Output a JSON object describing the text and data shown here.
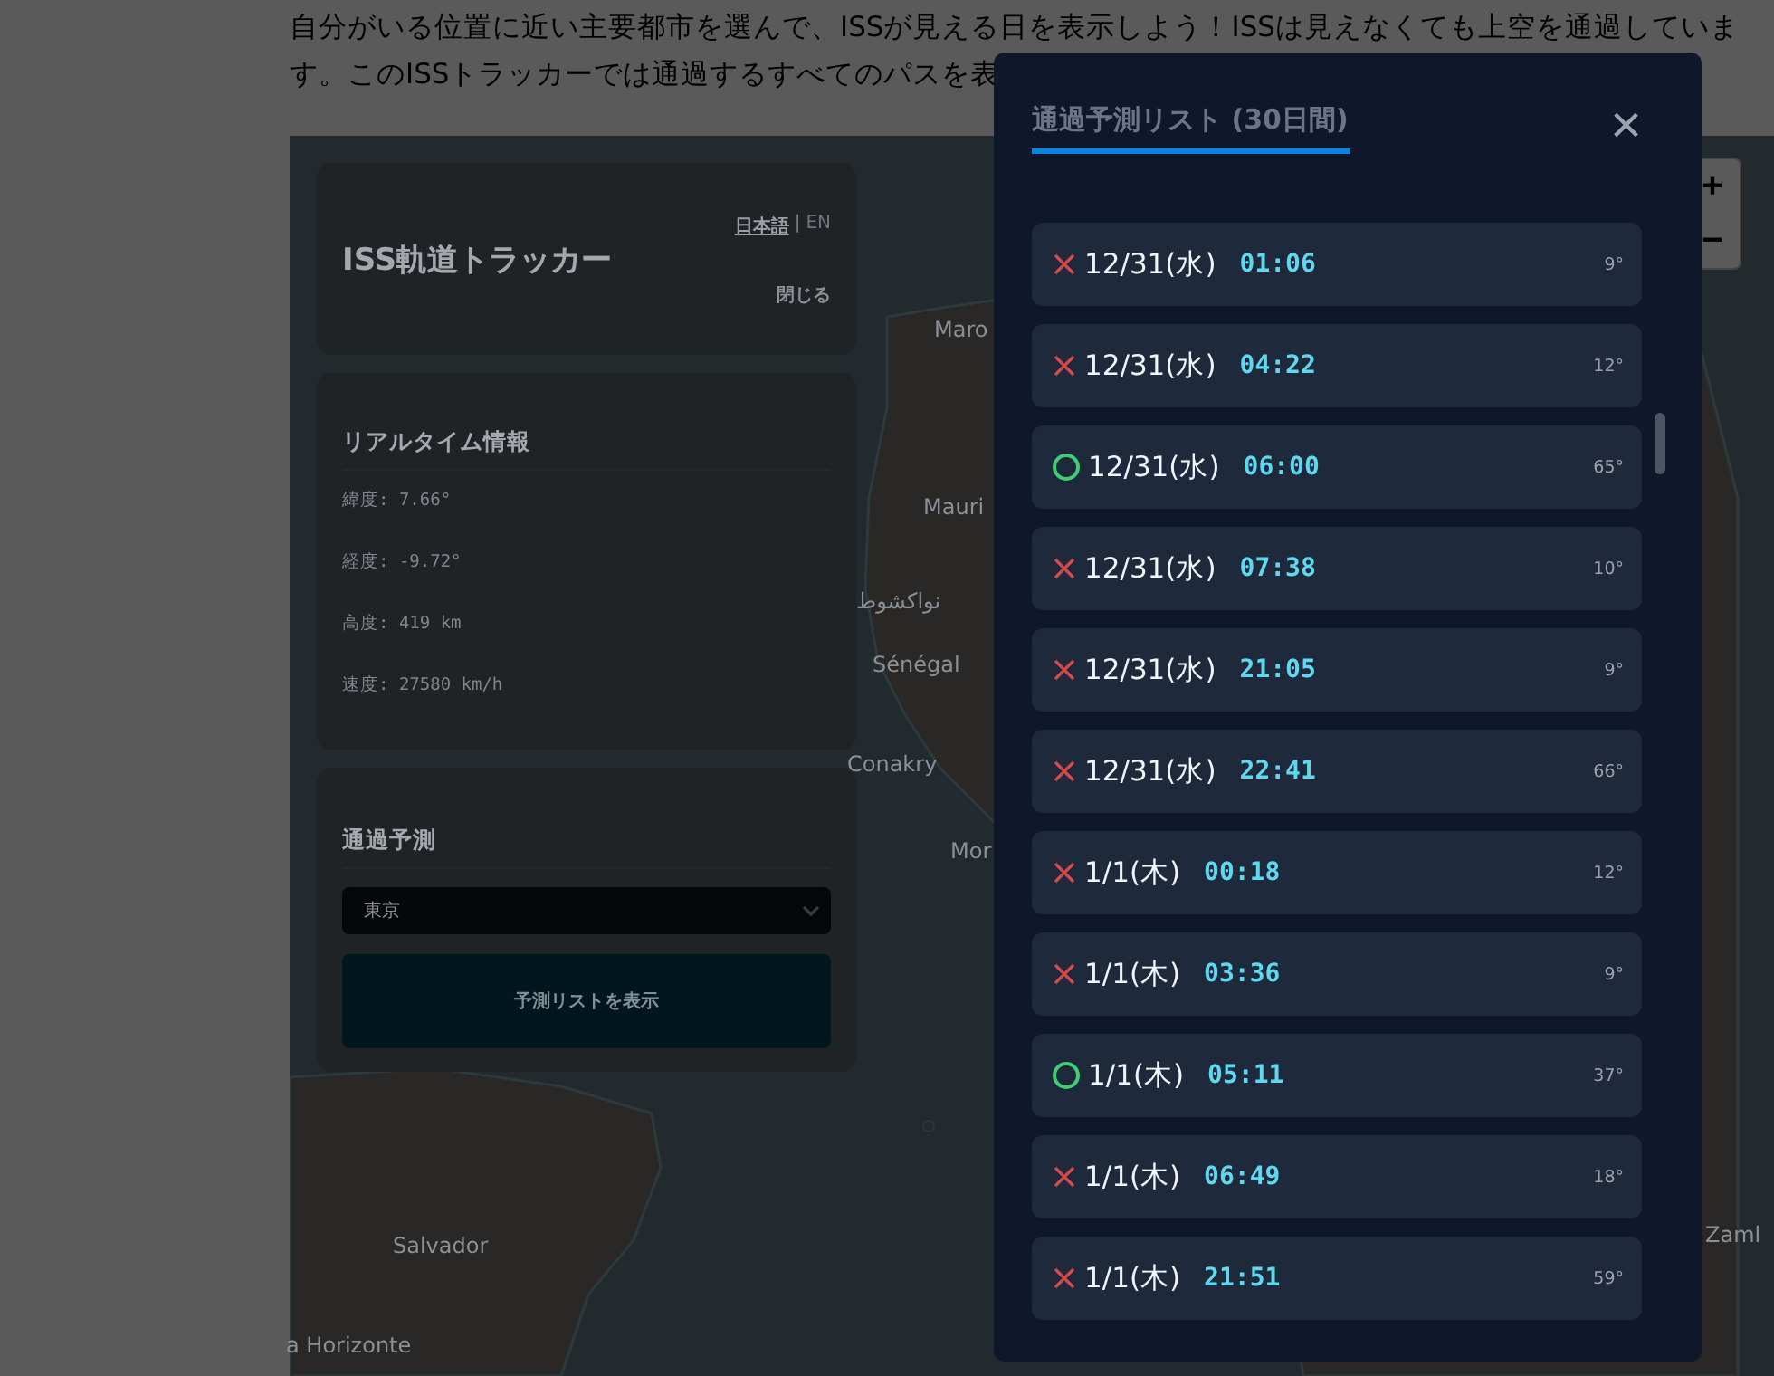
{
  "intro": {
    "lines": [
      "自分がいる位置に近い主要都市を選んで、ISSが見える日を表示しよう！ISSは見えなくても上空を通過していま",
      "す。このISSトラッカーでは通過するすべてのパスを表"
    ]
  },
  "map": {
    "labels": [
      "Maro",
      "Mauri",
      "نواكشوط",
      "Sénégal",
      "Conakry",
      "Mor",
      "Salvador",
      "a Horizonte",
      "Zaml"
    ],
    "zoom_controls": [
      "+",
      "−"
    ]
  },
  "tracker": {
    "title": "ISS軌道トラッカー",
    "languages": [
      {
        "label": "日本語",
        "selected": true
      },
      {
        "label": "EN",
        "selected": false
      }
    ],
    "separator": "|",
    "close": "閉じる",
    "realtime": {
      "heading": "リアルタイム情報",
      "rows": [
        "緯度: 7.66°",
        "経度: -9.72°",
        "高度: 419 km",
        "速度: 27580 km/h"
      ]
    },
    "prediction": {
      "heading": "通過予測",
      "city": "東京",
      "button": "予測リストを表示"
    }
  },
  "dialog": {
    "title": "通過予測リスト (30日間)",
    "close": "×",
    "passes": [
      {
        "visible": false,
        "date": "12/31(水)",
        "time": "01:06",
        "elevation": "9°"
      },
      {
        "visible": false,
        "date": "12/31(水)",
        "time": "04:22",
        "elevation": "12°"
      },
      {
        "visible": true,
        "date": "12/31(水)",
        "time": "06:00",
        "elevation": "65°"
      },
      {
        "visible": false,
        "date": "12/31(水)",
        "time": "07:38",
        "elevation": "10°"
      },
      {
        "visible": false,
        "date": "12/31(水)",
        "time": "21:05",
        "elevation": "9°"
      },
      {
        "visible": false,
        "date": "12/31(水)",
        "time": "22:41",
        "elevation": "66°"
      },
      {
        "visible": false,
        "date": "1/1(木)",
        "time": "00:18",
        "elevation": "12°"
      },
      {
        "visible": false,
        "date": "1/1(木)",
        "time": "03:36",
        "elevation": "9°"
      },
      {
        "visible": true,
        "date": "1/1(木)",
        "time": "05:11",
        "elevation": "37°"
      },
      {
        "visible": false,
        "date": "1/1(木)",
        "time": "06:49",
        "elevation": "18°"
      },
      {
        "visible": false,
        "date": "1/1(木)",
        "time": "21:51",
        "elevation": "59°"
      }
    ]
  }
}
